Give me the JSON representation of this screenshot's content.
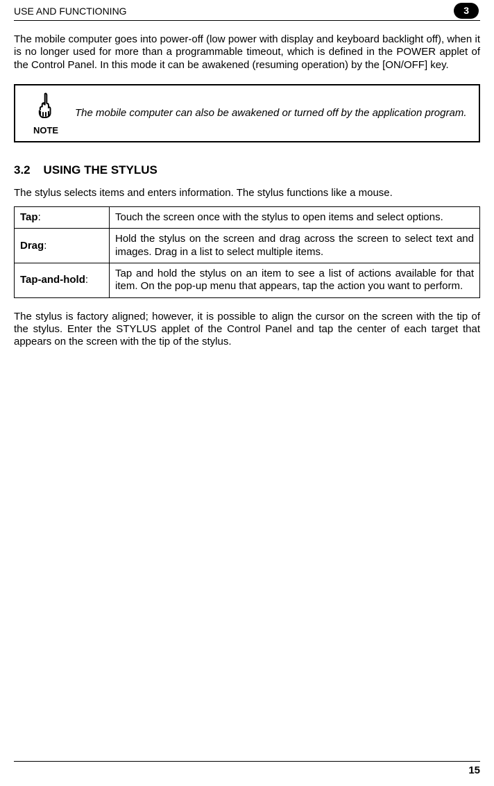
{
  "header": {
    "section_title": "USE AND FUNCTIONING",
    "chapter_number": "3"
  },
  "intro_paragraph": "The mobile computer goes into power-off (low power with display and keyboard backlight off), when it is no longer used for more than a programmable timeout, which is defined in the POWER applet of the Control Panel. In this mode it can be awakened (resuming operation) by the [ON/OFF] key.",
  "note": {
    "label": "NOTE",
    "content": "The mobile computer can also be awakened or turned off by the application program."
  },
  "section": {
    "number": "3.2",
    "title": "USING THE STYLUS"
  },
  "stylus_intro": "The stylus selects items and enters information. The stylus functions like a mouse.",
  "stylus_table": [
    {
      "term": "Tap",
      "desc": "Touch the screen once with the stylus to open items and select options."
    },
    {
      "term": "Drag",
      "desc": "Hold the stylus on the screen and drag across the screen to select text and images. Drag in a list to select multiple items."
    },
    {
      "term": "Tap-and-hold",
      "desc": "Tap and hold the stylus on an item to see a list of actions available for that item. On the pop-up menu that appears, tap the action you want to perform."
    }
  ],
  "stylus_outro": "The stylus is factory aligned; however, it is possible to align the cursor on the screen with the tip of the stylus. Enter the STYLUS applet of the Control Panel and tap the center of each target that appears on the screen with the tip of the stylus.",
  "footer": {
    "page_number": "15"
  }
}
